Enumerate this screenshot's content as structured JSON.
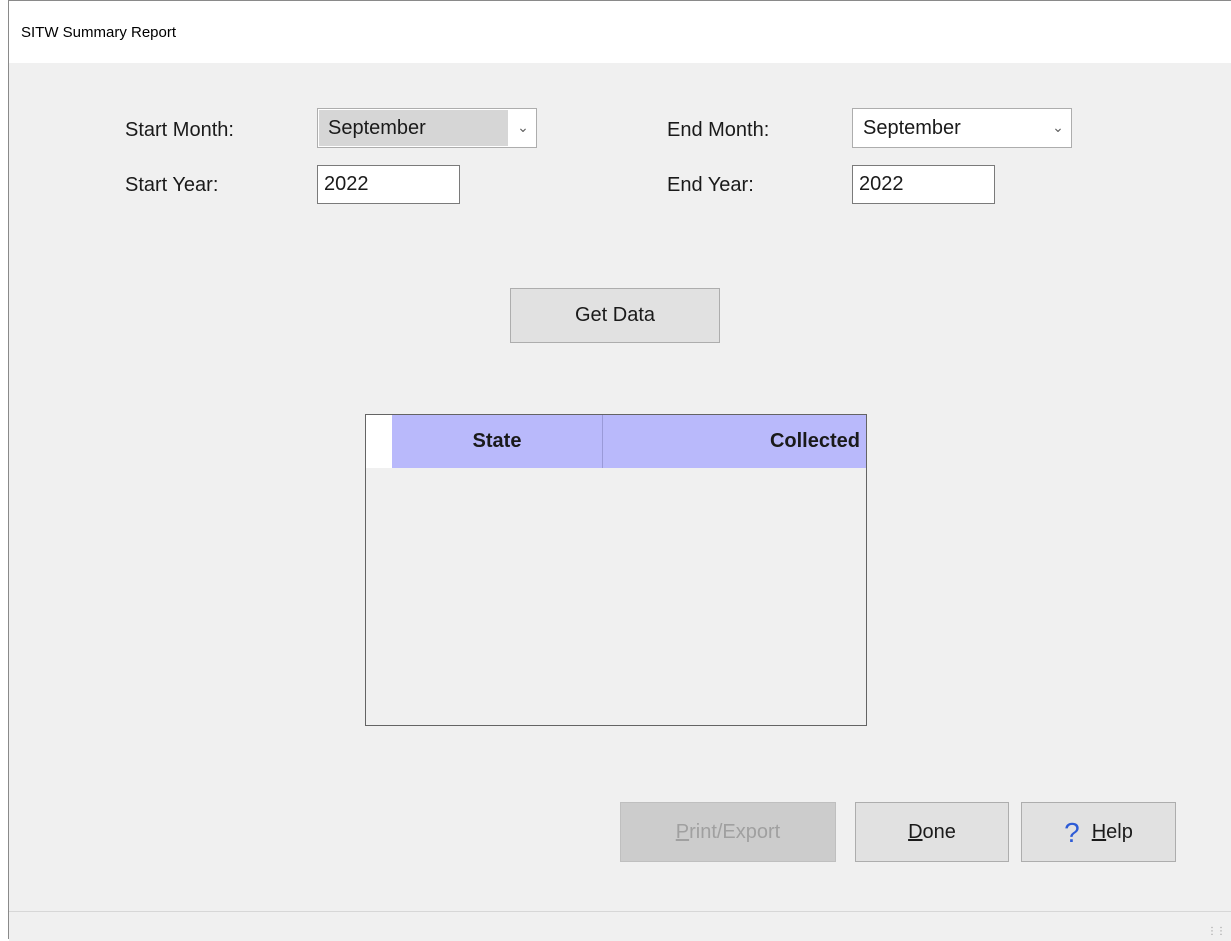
{
  "window": {
    "title": "SITW Summary Report"
  },
  "filters": {
    "start_month_label": "Start Month:",
    "start_month_value": "September",
    "start_year_label": "Start Year:",
    "start_year_value": "2022",
    "end_month_label": "End Month:",
    "end_month_value": "September",
    "end_year_label": "End Year:",
    "end_year_value": "2022"
  },
  "actions": {
    "get_data_label": "Get Data",
    "print_export_first": "P",
    "print_export_rest": "rint/Export",
    "done_first": "D",
    "done_rest": "one",
    "help_icon_glyph": "?",
    "help_first": "H",
    "help_rest": "elp"
  },
  "grid": {
    "columns": [
      "State",
      "Collected"
    ],
    "rows": []
  },
  "icons": {
    "dropdown": "chevron-down-icon",
    "help": "question-mark-icon",
    "resize_grip": "resize-grip-icon"
  },
  "colors": {
    "window_bg": "#f0f0f0",
    "grid_header_bg": "#b9b9fb",
    "help_icon": "#2e5cd6"
  }
}
